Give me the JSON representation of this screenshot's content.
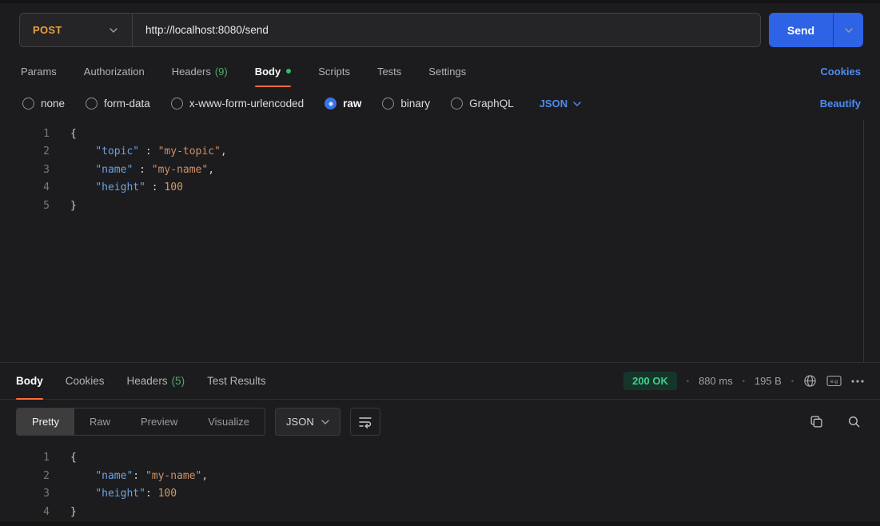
{
  "request": {
    "method": "POST",
    "url": "http://localhost:8080/send",
    "send_label": "Send",
    "tabs": [
      {
        "label": "Params"
      },
      {
        "label": "Authorization"
      },
      {
        "label": "Headers",
        "count": "(9)"
      },
      {
        "label": "Body"
      },
      {
        "label": "Scripts"
      },
      {
        "label": "Tests"
      },
      {
        "label": "Settings"
      }
    ],
    "active_tab": "Body",
    "cookies_link": "Cookies",
    "body_types": [
      {
        "label": "none"
      },
      {
        "label": "form-data"
      },
      {
        "label": "x-www-form-urlencoded"
      },
      {
        "label": "raw"
      },
      {
        "label": "binary"
      },
      {
        "label": "GraphQL"
      }
    ],
    "selected_body_type": "raw",
    "language": "JSON",
    "beautify_link": "Beautify"
  },
  "request_code": {
    "lines": [
      {
        "num": "1",
        "tokens": [
          {
            "text": "{",
            "type": "punct"
          }
        ]
      },
      {
        "num": "2",
        "tokens": [
          {
            "text": "    ",
            "type": "plain"
          },
          {
            "text": "\"topic\"",
            "type": "key"
          },
          {
            "text": " : ",
            "type": "punct"
          },
          {
            "text": "\"my-topic\"",
            "type": "string"
          },
          {
            "text": ",",
            "type": "punct"
          }
        ]
      },
      {
        "num": "3",
        "tokens": [
          {
            "text": "    ",
            "type": "plain"
          },
          {
            "text": "\"name\"",
            "type": "key"
          },
          {
            "text": " : ",
            "type": "punct"
          },
          {
            "text": "\"my-name\"",
            "type": "string"
          },
          {
            "text": ",",
            "type": "punct"
          }
        ]
      },
      {
        "num": "4",
        "tokens": [
          {
            "text": "    ",
            "type": "plain"
          },
          {
            "text": "\"height\"",
            "type": "key"
          },
          {
            "text": " : ",
            "type": "punct"
          },
          {
            "text": "100",
            "type": "number"
          }
        ]
      },
      {
        "num": "5",
        "tokens": [
          {
            "text": "}",
            "type": "punct"
          }
        ]
      }
    ]
  },
  "response": {
    "tabs": [
      {
        "label": "Body"
      },
      {
        "label": "Cookies"
      },
      {
        "label": "Headers",
        "count": "(5)"
      },
      {
        "label": "Test Results"
      }
    ],
    "active_tab": "Body",
    "status": "200 OK",
    "time": "880 ms",
    "size": "195 B",
    "meta_separator": "•",
    "views": [
      {
        "label": "Pretty"
      },
      {
        "label": "Raw"
      },
      {
        "label": "Preview"
      },
      {
        "label": "Visualize"
      }
    ],
    "selected_view": "Pretty",
    "language": "JSON"
  },
  "response_code": {
    "lines": [
      {
        "num": "1",
        "tokens": [
          {
            "text": "{",
            "type": "punct"
          }
        ]
      },
      {
        "num": "2",
        "tokens": [
          {
            "text": "    ",
            "type": "plain"
          },
          {
            "text": "\"name\"",
            "type": "key"
          },
          {
            "text": ": ",
            "type": "punct"
          },
          {
            "text": "\"my-name\"",
            "type": "string"
          },
          {
            "text": ",",
            "type": "punct"
          }
        ]
      },
      {
        "num": "3",
        "tokens": [
          {
            "text": "    ",
            "type": "plain"
          },
          {
            "text": "\"height\"",
            "type": "key"
          },
          {
            "text": ": ",
            "type": "punct"
          },
          {
            "text": "100",
            "type": "number"
          }
        ]
      },
      {
        "num": "4",
        "tokens": [
          {
            "text": "}",
            "type": "punct"
          }
        ]
      }
    ]
  },
  "colors": {
    "method_post": "#e8a13c",
    "send_button": "#2e63e6",
    "accent_link": "#4e8cf0",
    "active_tab_underline": "#ff6c37",
    "status_success_text": "#3fcf8e",
    "status_success_bg": "#16352a",
    "headers_count_green": "#4cae64",
    "body_indicator_green": "#2fbe62",
    "token_key": "#6ca2e0",
    "token_string": "#cd9069",
    "token_number": "#d19a66"
  }
}
